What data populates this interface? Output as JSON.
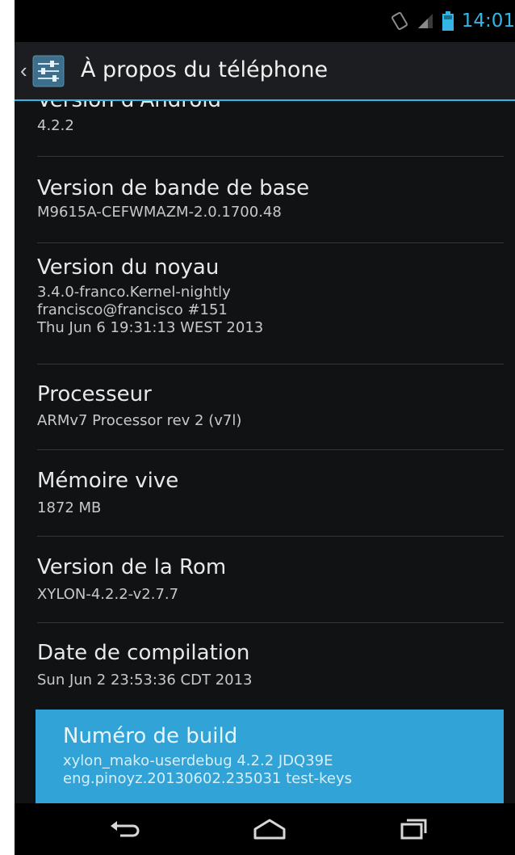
{
  "status_bar": {
    "time": "14:01",
    "icons": [
      "rotate-icon",
      "signal-icon",
      "battery-icon"
    ],
    "accent_color": "#33b5e5"
  },
  "action_bar": {
    "title": "À propos du téléphone",
    "icons": [
      "up-caret-icon",
      "settings-icon"
    ]
  },
  "items": [
    {
      "title": "Version d'Android",
      "lines": [
        "4.2.2"
      ]
    },
    {
      "title": "Version de bande de base",
      "lines": [
        "M9615A-CEFWMAZM-2.0.1700.48"
      ]
    },
    {
      "title": "Version du noyau",
      "lines": [
        "3.4.0-franco.Kernel-nightly",
        "francisco@francisco #151",
        "Thu Jun 6 19:31:13 WEST 2013"
      ]
    },
    {
      "title": "Processeur",
      "lines": [
        "ARMv7 Processor rev 2 (v7l)"
      ]
    },
    {
      "title": "Mémoire vive",
      "lines": [
        "1872 MB"
      ]
    },
    {
      "title": "Version de la Rom",
      "lines": [
        "XYLON-4.2.2-v2.7.7"
      ]
    },
    {
      "title": "Date de compilation",
      "lines": [
        "Sun Jun  2 23:53:36 CDT 2013"
      ]
    },
    {
      "title": "Numéro de build",
      "lines": [
        "xylon_mako-userdebug 4.2.2 JDQ39E",
        "eng.pinoyz.20130602.235031 test-keys"
      ],
      "highlight_color": "#31a3d6"
    }
  ],
  "nav_bar": {
    "buttons": [
      "back-icon",
      "home-icon",
      "recent-apps-icon"
    ]
  }
}
